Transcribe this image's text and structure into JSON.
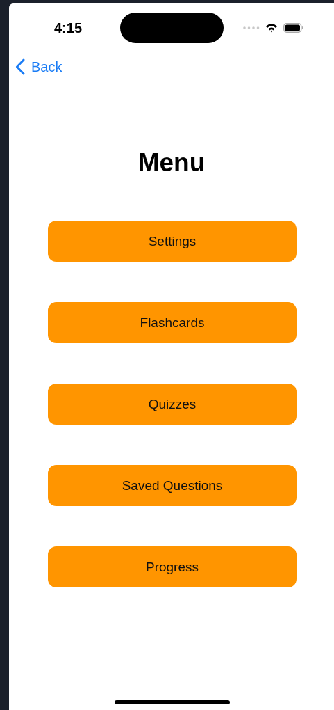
{
  "status_bar": {
    "time": "4:15"
  },
  "navigation": {
    "back_label": "Back"
  },
  "title": "Menu",
  "buttons": [
    {
      "label": "Settings"
    },
    {
      "label": "Flashcards"
    },
    {
      "label": "Quizzes"
    },
    {
      "label": "Saved Questions"
    },
    {
      "label": "Progress"
    }
  ]
}
